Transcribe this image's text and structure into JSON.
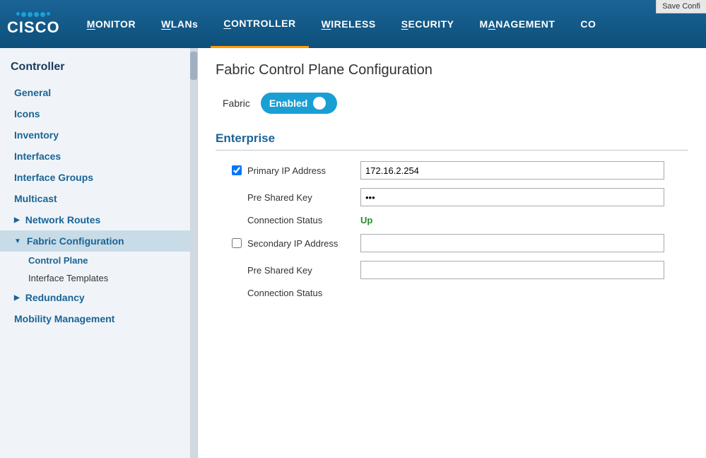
{
  "topbar": {
    "save_config": "Save Confi",
    "nav_items": [
      {
        "label": "MONITOR",
        "underline": "M",
        "active": false
      },
      {
        "label": "WLANs",
        "underline": "W",
        "active": false
      },
      {
        "label": "CONTROLLER",
        "underline": "C",
        "active": true
      },
      {
        "label": "WIRELESS",
        "underline": "W",
        "active": false
      },
      {
        "label": "SECURITY",
        "underline": "S",
        "active": false
      },
      {
        "label": "MANAGEMENT",
        "underline": "M",
        "active": false
      },
      {
        "label": "CO",
        "underline": "C",
        "active": false
      }
    ]
  },
  "sidebar": {
    "title": "Controller",
    "items": [
      {
        "label": "General",
        "type": "plain"
      },
      {
        "label": "Icons",
        "type": "plain"
      },
      {
        "label": "Inventory",
        "type": "plain"
      },
      {
        "label": "Interfaces",
        "type": "plain"
      },
      {
        "label": "Interface Groups",
        "type": "plain"
      },
      {
        "label": "Multicast",
        "type": "plain"
      },
      {
        "label": "Network Routes",
        "type": "arrow"
      },
      {
        "label": "Fabric Configuration",
        "type": "arrow-down",
        "active": true
      },
      {
        "label": "Control Plane",
        "type": "sub",
        "active": true
      },
      {
        "label": "Interface Templates",
        "type": "sub"
      },
      {
        "label": "Redundancy",
        "type": "arrow"
      },
      {
        "label": "Mobility Management",
        "type": "plain"
      }
    ]
  },
  "content": {
    "page_title": "Fabric Control Plane Configuration",
    "fabric_label": "Fabric",
    "toggle_label": "Enabled",
    "section_enterprise": "Enterprise",
    "primary_ip_label": "Primary IP Address",
    "primary_ip_value": "172.16.2.254",
    "pre_shared_key_label1": "Pre Shared Key",
    "pre_shared_key_placeholder1": "●●●",
    "connection_status_label1": "Connection Status",
    "connection_status_value1": "Up",
    "secondary_ip_label": "Secondary IP Address",
    "secondary_ip_value": "",
    "pre_shared_key_label2": "Pre Shared Key",
    "pre_shared_key_placeholder2": "",
    "connection_status_label2": "Connection Status",
    "connection_status_value2": ""
  }
}
